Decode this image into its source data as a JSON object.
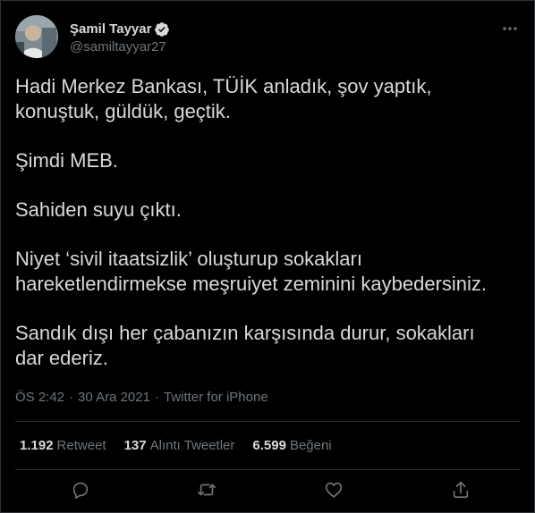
{
  "author": {
    "display_name": "Şamil Tayyar",
    "handle": "@samiltayyar27",
    "verified": true
  },
  "tweet": {
    "paragraphs": [
      "Hadi Merkez Bankası, TÜİK anladık, şov yaptık,\nkonuştuk, güldük, geçtik.",
      "Şimdi MEB.",
      "Sahiden suyu çıktı.",
      "Niyet ‘sivil itaatsizlik’ oluşturup sokakları\nhareketlendirmekse meşruiyet zeminini kaybedersiniz.",
      "Sandık dışı her çabanızın karşısında durur, sokakları\ndar ederiz."
    ]
  },
  "meta": {
    "time": "ÖS 2:42",
    "separator_1": "·",
    "date": "30 Ara 2021",
    "separator_2": "·",
    "source": "Twitter for iPhone"
  },
  "stats": {
    "retweets": {
      "value": "1.192",
      "label": "Retweet"
    },
    "quotes": {
      "value": "137",
      "label": "Alıntı Tweetler"
    },
    "likes": {
      "value": "6.599",
      "label": "Beğeni"
    }
  },
  "icons": {
    "more": "more-horizontal-icon",
    "verified": "verified-badge-icon",
    "reply": "reply-icon",
    "retweet": "retweet-icon",
    "like": "heart-icon",
    "share": "share-icon"
  },
  "colors": {
    "background": "#000000",
    "text": "#d9d9d9",
    "secondary_text": "#6e767d",
    "border": "#2f3336",
    "verified": "#d9d9d9"
  }
}
